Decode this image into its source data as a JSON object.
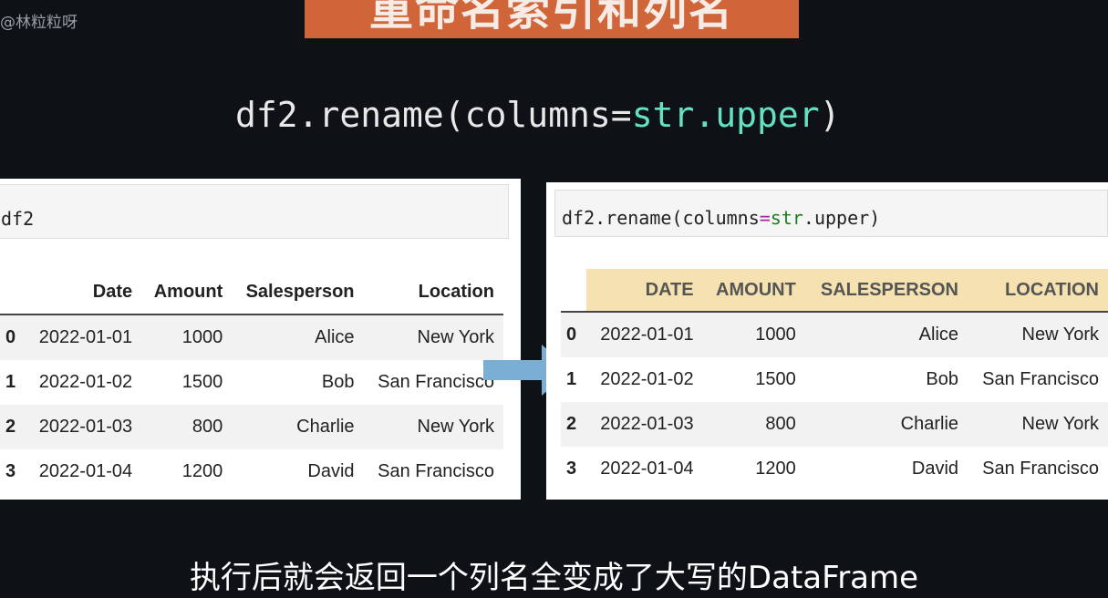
{
  "watermark": "@林粒粒呀",
  "title": "重命名索引和列名",
  "big_code": {
    "prefix": "df2.rename(columns=",
    "highlight": "str.upper",
    "suffix": ")"
  },
  "left_panel": {
    "code": "df2",
    "table": {
      "columns": [
        "Date",
        "Amount",
        "Salesperson",
        "Location"
      ],
      "rows": [
        {
          "index": "0",
          "cells": [
            "2022-01-01",
            "1000",
            "Alice",
            "New York"
          ]
        },
        {
          "index": "1",
          "cells": [
            "2022-01-02",
            "1500",
            "Bob",
            "San Francisco"
          ]
        },
        {
          "index": "2",
          "cells": [
            "2022-01-03",
            "800",
            "Charlie",
            "New York"
          ]
        },
        {
          "index": "3",
          "cells": [
            "2022-01-04",
            "1200",
            "David",
            "San Francisco"
          ]
        }
      ]
    }
  },
  "right_panel": {
    "code": {
      "obj": "df2.rename(columns",
      "op": "=",
      "fn": "str",
      "rest": ".upper)"
    },
    "table": {
      "columns": [
        "DATE",
        "AMOUNT",
        "SALESPERSON",
        "LOCATION"
      ],
      "rows": [
        {
          "index": "0",
          "cells": [
            "2022-01-01",
            "1000",
            "Alice",
            "New York"
          ]
        },
        {
          "index": "1",
          "cells": [
            "2022-01-02",
            "1500",
            "Bob",
            "San Francisco"
          ]
        },
        {
          "index": "2",
          "cells": [
            "2022-01-03",
            "800",
            "Charlie",
            "New York"
          ]
        },
        {
          "index": "3",
          "cells": [
            "2022-01-04",
            "1200",
            "David",
            "San Francisco"
          ]
        }
      ],
      "header_highlight": "#f6e2b0"
    }
  },
  "arrow": {
    "icon": "arrow-right-icon",
    "color": "#7aaed3"
  },
  "subtitle": "执行后就会返回一个列名全变成了大写的DataFrame",
  "colors": {
    "background": "#0e1216",
    "banner": "#d0653a",
    "code_highlight": "#66e0c2"
  }
}
